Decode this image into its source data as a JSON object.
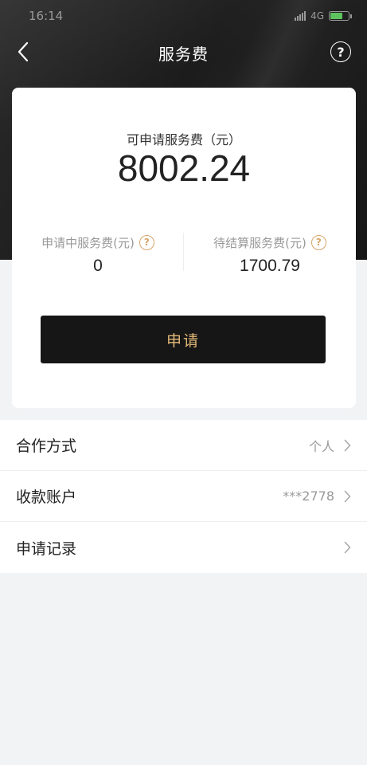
{
  "status_bar": {
    "time": "16:14",
    "network": "4G"
  },
  "nav": {
    "title": "服务费",
    "back_icon": "chevron-left-icon",
    "help_icon": "help-icon",
    "help_glyph": "?"
  },
  "summary": {
    "available_label": "可申请服务费（元）",
    "available_value": "8002.24",
    "pending_label": "申请中服务费(元)",
    "pending_value": "0",
    "unsettled_label": "待结算服务费(元)",
    "unsettled_value": "1700.79",
    "info_glyph": "?",
    "apply_button": "申请"
  },
  "menu": {
    "items": [
      {
        "label": "合作方式",
        "value": "个人"
      },
      {
        "label": "收款账户",
        "value": "***2778"
      },
      {
        "label": "申请记录",
        "value": ""
      }
    ]
  },
  "colors": {
    "accent_gold": "#e3b97a",
    "info_orange": "#d9a56b",
    "button_dark": "#161616"
  }
}
